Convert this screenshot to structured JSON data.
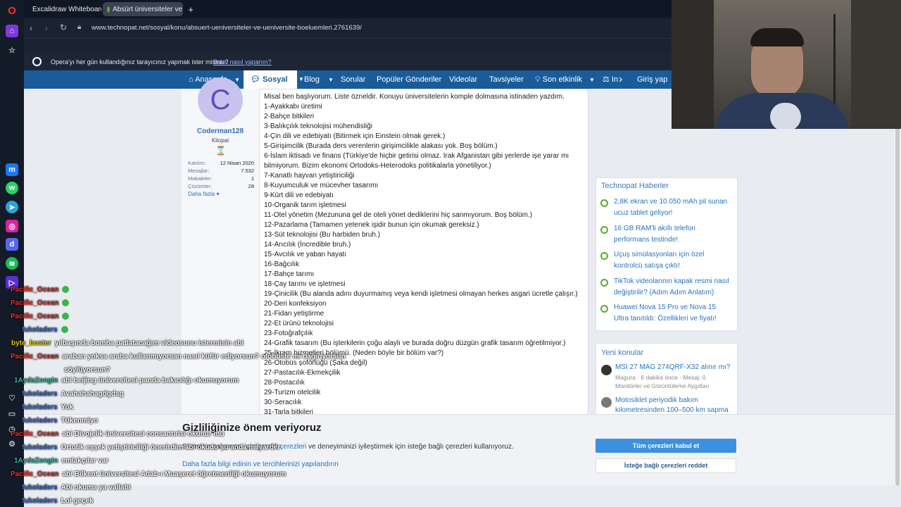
{
  "browser": {
    "tabs": [
      {
        "label": "Excalidraw Whiteboard"
      },
      {
        "label": "Absürt üniversiteler ve ün"
      }
    ],
    "new_tab": "+",
    "url": "www.technopat.net/sosyal/konu/absuert-ueniversiteler-ve-ueniversite-boeluemleri.2761639/",
    "infobar_text": "Opera'yı her gün kullandığınız tarayıcınız yapmak ister misiniz?",
    "infobar_link": "Bunu nasıl yaparım?"
  },
  "nav": {
    "items": [
      "Anasayfa",
      "Sosyal",
      "Blog",
      "Sorular",
      "Popüler Gönderiler",
      "Videolar",
      "Tavsiyeler",
      "Son etkinlik",
      "In"
    ],
    "login": "Giriş yap"
  },
  "post": {
    "author": {
      "initial": "C",
      "name": "Coderman128",
      "rank": "Kilopat",
      "stats": [
        {
          "label": "Katılım:",
          "value": "12 Nisan 2020"
        },
        {
          "label": "Mesajlar:",
          "value": "7.532"
        },
        {
          "label": "Makaleler:",
          "value": "1"
        },
        {
          "label": "Çözümler:",
          "value": "28"
        }
      ],
      "more": "Daha fazla"
    },
    "lines": [
      "Misal ben başlıyorum. Liste özneldir. Konuyu üniversitelerin komple dolmasına istinaden yazdım.",
      "1-Ayakkabı üretimi",
      "2-Bahçe bitkileri",
      "3-Balıkçılık teknolojisi mühendisliği",
      "4-Çin dili ve edebiyatı (Bitirmek için Einstein olmak gerek.)",
      "5-Girişimcilik (Burada ders verenlerin girişimcilikle alakası yok. Boş bölüm.)",
      "6-İslam iktisadı ve finans (Türkiye'de hiçbir getirisi olmaz. Irak Afganistan gibi yerlerde işe yarar mı",
      "bilmiyorum. Bizim ekonomi Ortodoks-Heterodoks politikalarla yönetiliyor.)",
      "7-Kanatlı hayvan yetiştiriciliği",
      "8-Kuyumculuk ve mücevher tasarımı",
      "9-Kürt dili ve edebiyatı",
      "10-Organik tarım işletmesi",
      "11-Otel yönetim (Mezununa gel de oteli yönet dediklerini hiç sanmıyorum. Boş bölüm.)",
      "12-Pazarlama (Tamamen yetenek işidir bunun için okumak gereksiz.)",
      "13-Süt teknolojisi (Bu harbiden bruh.)",
      "14-Arıcılık (İncredible bruh.)",
      "15-Avcılık ve yaban hayatı",
      "16-Bağcılık",
      "17-Bahçe tarımı",
      "18-Çay tarımı ve işletmesi",
      "19-Çinicilik (Bu alanda adını duyurmamış veya kendi işletmesi olmayan herkes asgari ücretle çalışır.)",
      "20-Deri konfeksiyon",
      "21-Fidan yetiştirme",
      "22-Et ürünü teknolojisi",
      "23-Fotoğrafçılık",
      "24-Grafik tasarım (Bu işterkilerin çoğu alaylı ve burada doğru düzgün grafik tasarım öğretilmiyor.)",
      "25-İkram hizmetleri bölümü. (Neden böyle bir bölüm var?)",
      "26-Otobüs şoförlüğü (Şaka değil)",
      "27-Pastacılık-Ekmekçilik",
      "28-Postacılık",
      "29-Turizm otelcilik",
      "30-Seracılık",
      "31-Tarla bitkileri"
    ]
  },
  "sidebar": {
    "news_title": "Technopat Haberler",
    "news": [
      "2,8K ekran ve 10.050 mAh pil sunan ucuz tablet geliyor!",
      "16 GB RAM'li akıllı telefon performans testinde!",
      "Uçuş simülasyonları için özel kontrolcü satışa çıktı!",
      "TikTok videolarının kapak resmi nasıl değiştirilir? (Adım Adım Anlatım)",
      "Huawei Nova 15 Pro ve Nova 15 Ultra tanıtıldı: Özellikleri ve fiyatı!"
    ],
    "topics_title": "Yeni konular",
    "topics": [
      {
        "title": "MSI 27 MAG 274QRF-X32 alınır mı?",
        "meta": "Magura · 6 dakika önce · Mesaj: 0",
        "forum": "Monitörler ve Görüntüleme Aygıtları"
      },
      {
        "title": "Motosiklet periyodik bakım kilometresinden 100–500 km sapma",
        "meta": "",
        "forum": ""
      }
    ]
  },
  "cookie": {
    "title": "Gizliliğinize önem veriyoruz",
    "text_before": "Sitemizin çalışması için gerekli",
    "link": "çerezleri",
    "text_after": "ve deneyiminizi iyileştirmek için isteğe bağlı çerezleri kullanıyoruz.",
    "more_link": "Daha fazla bilgi edinin ve tercihlerinizi yapılandırın",
    "accept": "Tüm çerezleri kabul et",
    "reject": "İsteğe bağlı çerezleri reddet"
  },
  "chat": [
    {
      "user": "Pacific_Ocean",
      "color": "#e0352b",
      "msg": "",
      "emote": true
    },
    {
      "user": "Pacific_Ocean",
      "color": "#e0352b",
      "msg": "",
      "emote": true
    },
    {
      "user": "Pacific_Ocean",
      "color": "#e0352b",
      "msg": "",
      "emote": true
    },
    {
      "user": "fukoladers",
      "color": "#3d6fe0",
      "msg": "",
      "emote": true
    },
    {
      "user": "byte_buster",
      "color": "#e8c400",
      "msg": "yılbaşında bomba patlatacağım videosunu istermisin abi"
    },
    {
      "user": "Pacific_Ocean",
      "color": "#e0352b",
      "msg": "araban yoksa araba kullanmıyorsan nasıl küfür ediyorsun? otobüste mi bağırıyorsun"
    },
    {
      "user": "",
      "color": "#e0352b",
      "msg": "söylüyorsun?"
    },
    {
      "user": "1AydaZengin",
      "color": "#3bb5a0",
      "msg": "abi beijing üniversitesi panda bakıcılığı okumuyorum"
    },
    {
      "user": "fukoladers",
      "color": "#3d6fe0",
      "msg": "Avahahahagdgdsg"
    },
    {
      "user": "fukoladers",
      "color": "#3d6fe0",
      "msg": "Yok"
    },
    {
      "user": "fukoladers",
      "color": "#3d6fe0",
      "msg": "Tükenmiyo"
    },
    {
      "user": "Pacific_Ocean",
      "color": "#e0352b",
      "msg": "abi Divojelik üniversitesi consantırisi okunur mu"
    },
    {
      "user": "fukoladers",
      "color": "#3d6fe0",
      "msg": "Ortotik eşşek yetiştiriciliği önerirdim abi okudu şu anda milyarder"
    },
    {
      "user": "1AydaZengin",
      "color": "#3bb5a0",
      "msg": "emlakçılar var"
    },
    {
      "user": "Pacific_Ocean",
      "color": "#e0352b",
      "msg": "abi Bilkent üniversitesi Adab-ı Muaşeret öğretmenliği okumuyorum"
    },
    {
      "user": "fukoladers",
      "color": "#3d6fe0",
      "msg": "Abi okuma ya vallahi"
    },
    {
      "user": "fukoladers",
      "color": "#3d6fe0",
      "msg": "Lol geçek"
    }
  ]
}
